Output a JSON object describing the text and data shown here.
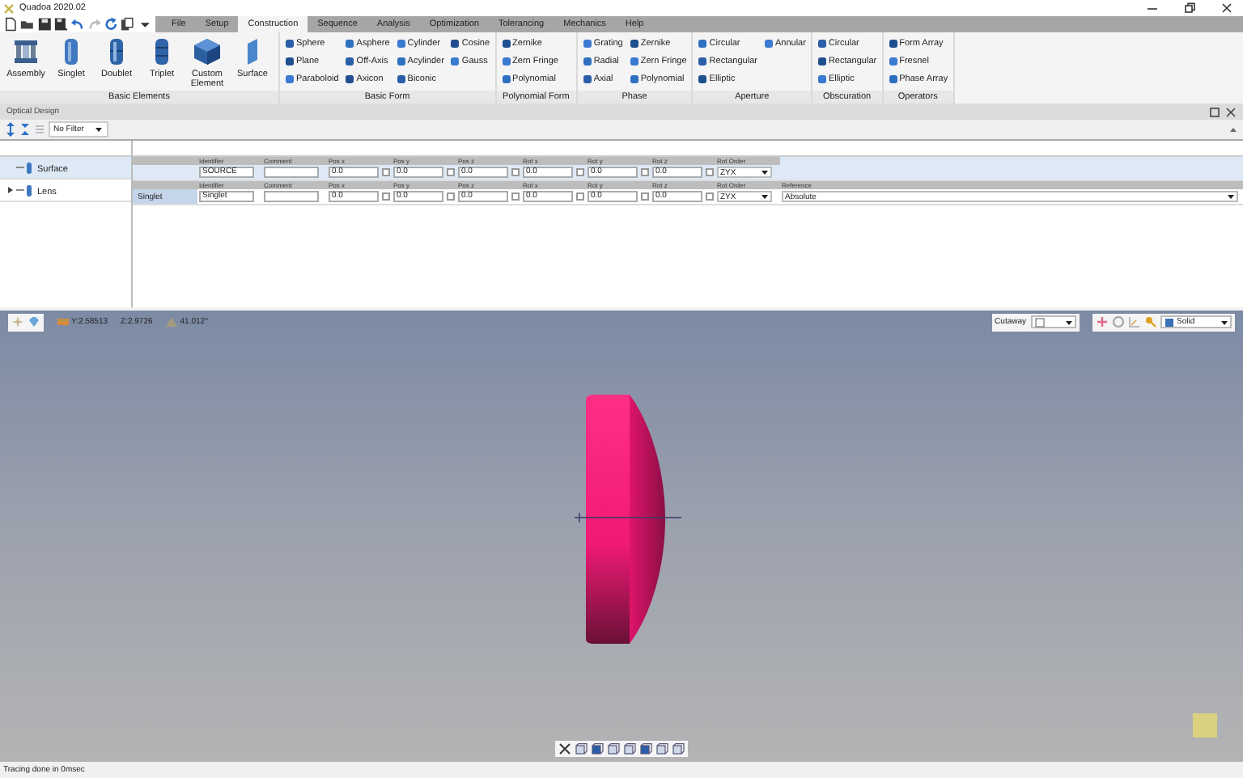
{
  "window": {
    "title": "Quadoa 2020.02"
  },
  "menu_tabs": [
    {
      "label": "File",
      "selected": false
    },
    {
      "label": "Setup",
      "selected": false
    },
    {
      "label": "Construction",
      "selected": true
    },
    {
      "label": "Sequence",
      "selected": false
    },
    {
      "label": "Analysis",
      "selected": false
    },
    {
      "label": "Optimization",
      "selected": false
    },
    {
      "label": "Tolerancing",
      "selected": false
    },
    {
      "label": "Mechanics",
      "selected": false
    },
    {
      "label": "Help",
      "selected": false
    }
  ],
  "ribbon": {
    "groups": [
      {
        "label": "Basic Elements",
        "kind": "large",
        "items": [
          {
            "label": "Assembly"
          },
          {
            "label": "Singlet"
          },
          {
            "label": "Doublet"
          },
          {
            "label": "Triplet"
          },
          {
            "label": "Custom Element"
          },
          {
            "label": "Surface"
          }
        ]
      },
      {
        "label": "Basic Form",
        "kind": "small",
        "items": [
          {
            "label": "Sphere"
          },
          {
            "label": "Plane"
          },
          {
            "label": "Paraboloid"
          },
          {
            "label": "Asphere"
          },
          {
            "label": "Off-Axis"
          },
          {
            "label": "Axicon"
          },
          {
            "label": "Cylinder"
          },
          {
            "label": "Acylinder"
          },
          {
            "label": "Biconic"
          },
          {
            "label": "Cosine"
          },
          {
            "label": "Gauss"
          }
        ]
      },
      {
        "label": "Polynomial Form",
        "kind": "small",
        "items": [
          {
            "label": "Zernike"
          },
          {
            "label": "Zern Fringe"
          },
          {
            "label": "Polynomial"
          }
        ]
      },
      {
        "label": "Phase",
        "kind": "small",
        "items": [
          {
            "label": "Grating"
          },
          {
            "label": "Radial"
          },
          {
            "label": "Axial"
          },
          {
            "label": "Zernike"
          },
          {
            "label": "Zern Fringe"
          },
          {
            "label": "Polynomial"
          }
        ]
      },
      {
        "label": "Aperture",
        "kind": "small",
        "items": [
          {
            "label": "Circular"
          },
          {
            "label": "Rectangular"
          },
          {
            "label": "Elliptic"
          },
          {
            "label": "Annular"
          }
        ]
      },
      {
        "label": "Obscuration",
        "kind": "small",
        "items": [
          {
            "label": "Circular"
          },
          {
            "label": "Rectangular"
          },
          {
            "label": "Elliptic"
          }
        ]
      },
      {
        "label": "Operators",
        "kind": "small",
        "items": [
          {
            "label": "Form Array"
          },
          {
            "label": "Fresnel"
          },
          {
            "label": "Phase Array"
          }
        ]
      }
    ]
  },
  "optical_design": {
    "title": "Optical Design",
    "filter": "No Filter",
    "rows": [
      {
        "label": "Surface",
        "selected": true,
        "columns": [
          {
            "kind": "text",
            "label": "Identifier",
            "value": "SOURCE"
          },
          {
            "kind": "text",
            "label": "Comment"
          },
          {
            "kind": "number",
            "label": "Pos x",
            "value": "0.0",
            "checked": false
          },
          {
            "kind": "number",
            "label": "Pos y",
            "value": "0.0",
            "checked": false
          },
          {
            "kind": "number",
            "label": "Pos z",
            "value": "0.0",
            "checked": false
          },
          {
            "kind": "number",
            "label": "Rot x",
            "value": "0.0",
            "checked": false
          },
          {
            "kind": "number",
            "label": "Rot y",
            "value": "0.0",
            "checked": false
          },
          {
            "kind": "number",
            "label": "Rot z",
            "value": "0.0",
            "checked": false
          },
          {
            "kind": "dropdown",
            "label": "Rot Order",
            "value": "ZYX"
          }
        ]
      },
      {
        "label": "Lens",
        "selected": false,
        "expanded": false,
        "type": "Singlet",
        "columns": [
          {
            "kind": "text",
            "label": "Identifier",
            "value": "Singlet"
          },
          {
            "kind": "text",
            "label": "Comment"
          },
          {
            "kind": "number",
            "label": "Pos x",
            "value": "0.0",
            "checked": false
          },
          {
            "kind": "number",
            "label": "Pos y",
            "value": "0.0",
            "checked": false
          },
          {
            "kind": "number",
            "label": "Pos z",
            "value": "0.0",
            "checked": false
          },
          {
            "kind": "number",
            "label": "Rot x",
            "value": "0.0",
            "checked": false
          },
          {
            "kind": "number",
            "label": "Rot y",
            "value": "0.0",
            "checked": false
          },
          {
            "kind": "number",
            "label": "Rot z",
            "value": "0.0",
            "checked": false
          },
          {
            "kind": "dropdown",
            "label": "Rot Order",
            "value": "ZYX"
          },
          {
            "kind": "wide-dropdown",
            "label": "Reference",
            "value": "Absolute"
          }
        ]
      }
    ]
  },
  "viewport": {
    "readouts": [
      "Y:2.58513",
      "Z:2.9726",
      "41.012°"
    ],
    "cutaway": "Cutaway",
    "display_mode": "Solid"
  },
  "status_bar": {
    "text": "Tracing done in 0msec"
  }
}
